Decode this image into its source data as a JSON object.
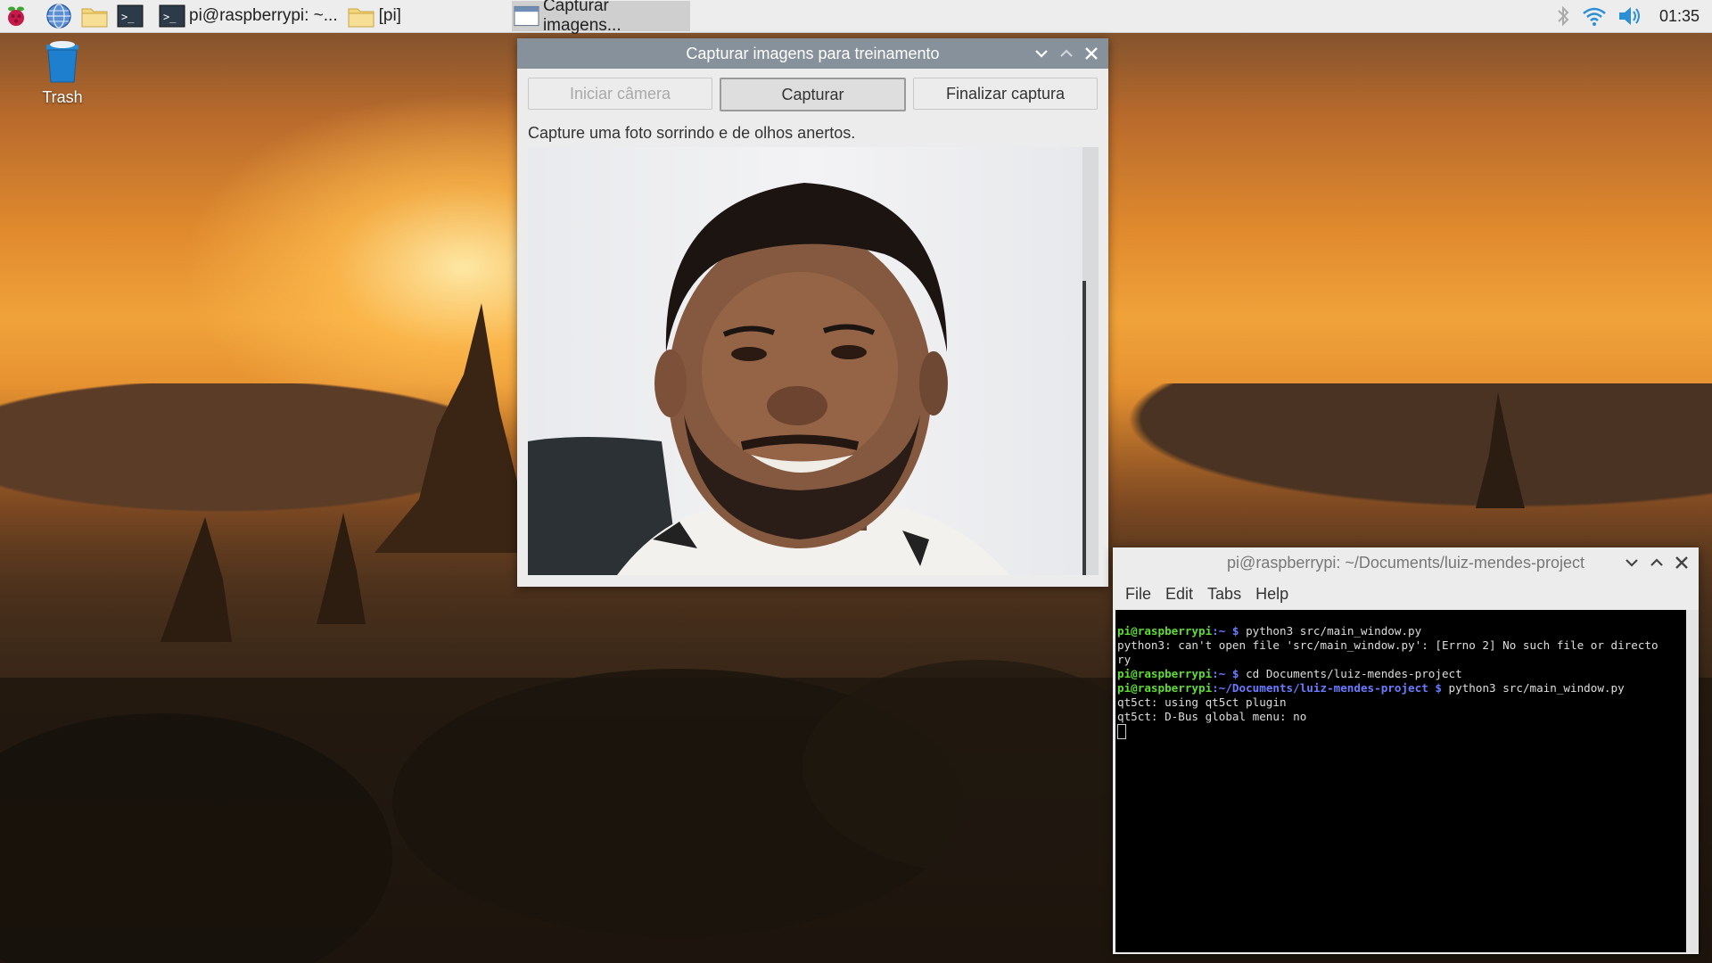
{
  "panel": {
    "terminal_task_label": "pi@raspberrypi: ~...",
    "folder_task_label": "[pi]",
    "capture_task_label": "Capturar imagens...",
    "clock": "01:35"
  },
  "desktop": {
    "trash_label": "Trash"
  },
  "capture_window": {
    "title": "Capturar imagens para treinamento",
    "buttons": {
      "start_camera": "Iniciar câmera",
      "capture": "Capturar",
      "finish": "Finalizar captura"
    },
    "instruction": "Capture uma foto sorrindo e de olhos anertos."
  },
  "terminal_window": {
    "title": "pi@raspberrypi: ~/Documents/luiz-mendes-project",
    "menu": [
      "File",
      "Edit",
      "Tabs",
      "Help"
    ],
    "lines": [
      {
        "user": "pi@raspberrypi",
        "path": ":~ $",
        "cmd": " python3 src/main_window.py"
      },
      {
        "out": "python3: can't open file 'src/main_window.py': [Errno 2] No such file or directo"
      },
      {
        "out": "ry"
      },
      {
        "user": "pi@raspberrypi",
        "path": ":~ $",
        "cmd": " cd Documents/luiz-mendes-project"
      },
      {
        "user": "pi@raspberrypi",
        "path": ":~/Documents/luiz-mendes-project $",
        "cmd": " python3 src/main_window.py"
      },
      {
        "out": "qt5ct: using qt5ct plugin"
      },
      {
        "out": "qt5ct: D-Bus global menu: no"
      }
    ]
  },
  "colors": {
    "titlebar_active": "#87919b",
    "prompt_user": "#5fdc32",
    "prompt_path": "#6b7bff"
  }
}
